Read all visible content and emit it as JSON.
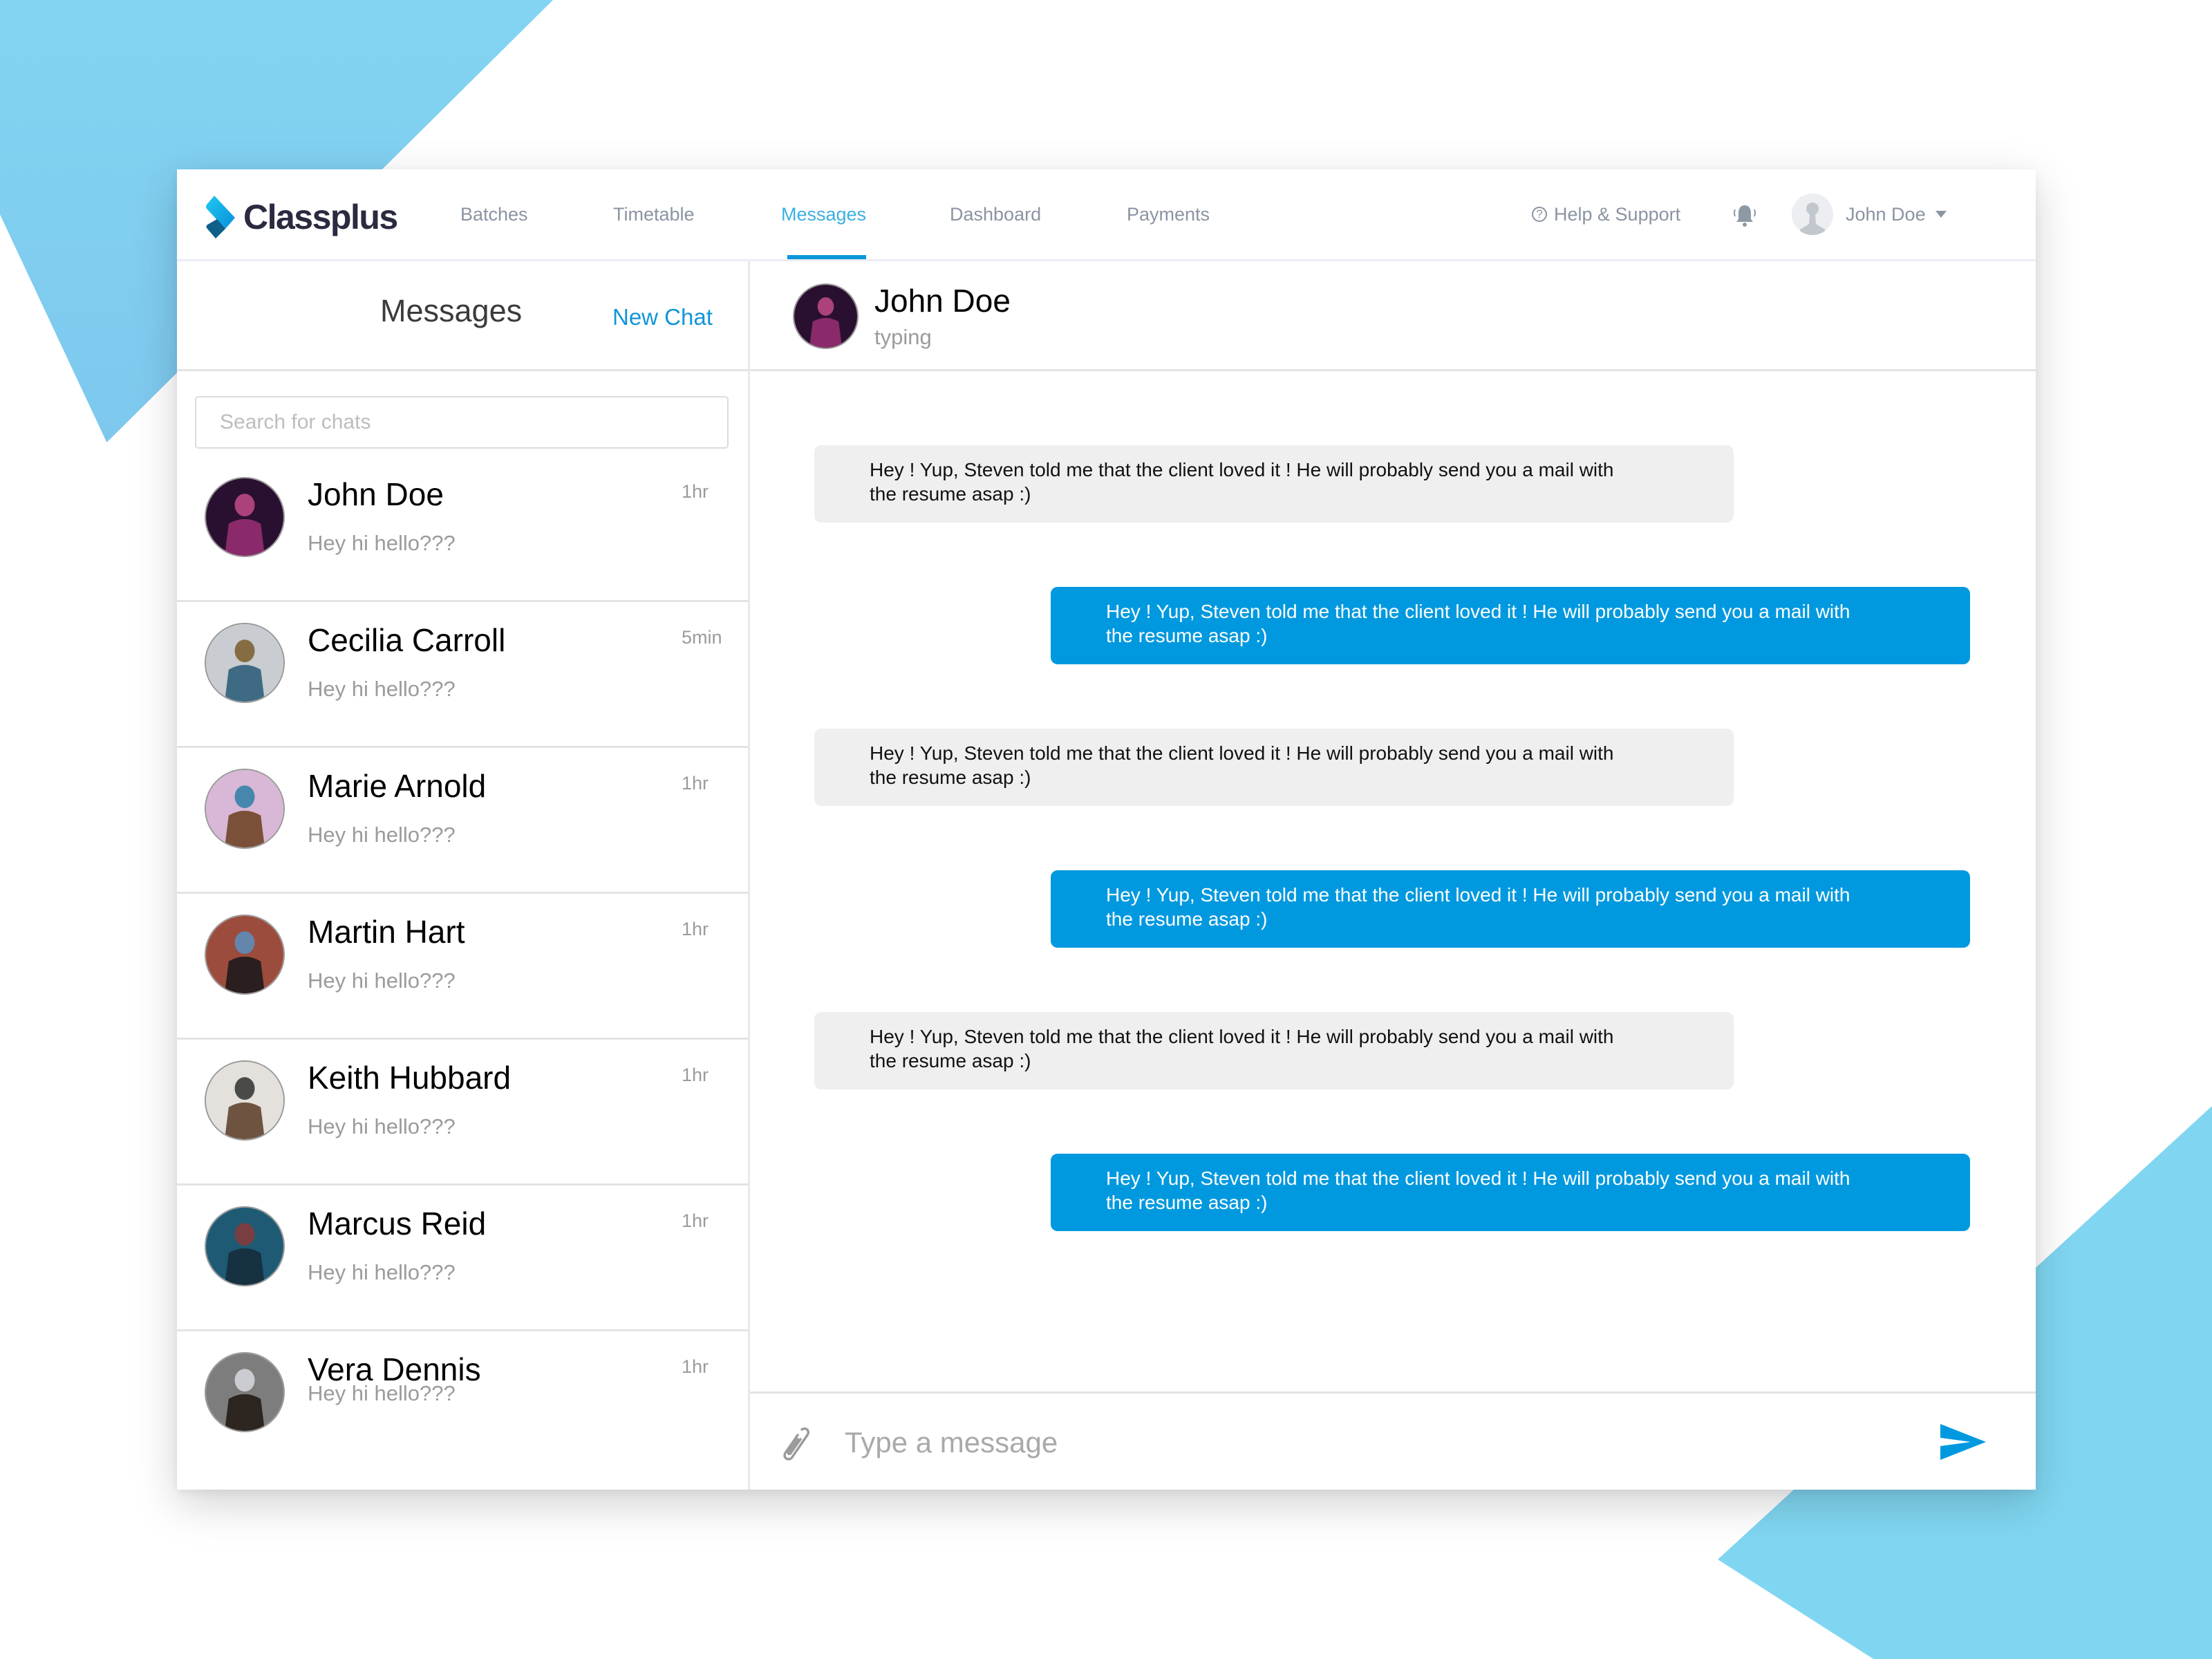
{
  "brand": {
    "name": "Classplus"
  },
  "nav": {
    "items": [
      {
        "label": "Batches",
        "active": false
      },
      {
        "label": "Timetable",
        "active": false
      },
      {
        "label": "Messages",
        "active": true
      },
      {
        "label": "Dashboard",
        "active": false
      },
      {
        "label": "Payments",
        "active": false
      }
    ],
    "help_label": "Help & Support",
    "user_name": "John Doe"
  },
  "sidebar": {
    "title": "Messages",
    "new_chat_label": "New Chat",
    "search_placeholder": "Search for chats",
    "search_value": "",
    "chats": [
      {
        "name": "John Doe",
        "preview": "Hey hi hello???",
        "time": "1hr",
        "avatar_colors": [
          "#2a1030",
          "#8a2a6a",
          "#c34b8a"
        ]
      },
      {
        "name": "Cecilia Carroll",
        "preview": "Hey hi hello???",
        "time": "5min",
        "avatar_colors": [
          "#c9ccd0",
          "#3e6b83",
          "#7a5a2a"
        ]
      },
      {
        "name": "Marie Arnold",
        "preview": "Hey hi hello???",
        "time": "1hr",
        "avatar_colors": [
          "#d9b7d6",
          "#7a5038",
          "#2d7fa6"
        ]
      },
      {
        "name": "Martin Hart",
        "preview": "Hey hi hello???",
        "time": "1hr",
        "avatar_colors": [
          "#9c4c3c",
          "#2b1e1e",
          "#5b8fbf"
        ]
      },
      {
        "name": "Keith Hubbard",
        "preview": "Hey hi hello???",
        "time": "1hr",
        "avatar_colors": [
          "#e4e1dc",
          "#6e5440",
          "#2f2f2f"
        ]
      },
      {
        "name": "Marcus Reid",
        "preview": "Hey hi hello???",
        "time": "1hr",
        "avatar_colors": [
          "#1f5a74",
          "#163142",
          "#8a3a3a"
        ]
      },
      {
        "name": "Vera Dennis",
        "preview": "Hey hi hello???",
        "time": "1hr",
        "avatar_colors": [
          "#7d7d7d",
          "#2c2520",
          "#d8d8e0"
        ]
      }
    ]
  },
  "chat": {
    "contact_name": "John Doe",
    "status": "typing",
    "messages": [
      {
        "direction": "in",
        "line1": "Hey ! Yup, Steven told me that the client loved it ! He will probably send you a mail with",
        "line2": "the resume asap :)"
      },
      {
        "direction": "out",
        "line1": "Hey ! Yup, Steven told me that the client loved it ! He will probably send you a mail with",
        "line2": "the resume asap :)"
      },
      {
        "direction": "in",
        "line1": "Hey ! Yup, Steven told me that the client loved it ! He will probably send you a mail with",
        "line2": "the resume asap :)"
      },
      {
        "direction": "out",
        "line1": "Hey ! Yup, Steven told me that the client loved it ! He will probably send you a mail with",
        "line2": "the resume asap :)"
      },
      {
        "direction": "in",
        "line1": "Hey ! Yup, Steven told me that the client loved it ! He will probably send you a mail with",
        "line2": "the resume asap :)"
      },
      {
        "direction": "out",
        "line1": "Hey ! Yup, Steven told me that the client loved it ! He will probably send you a mail with",
        "line2": "the resume asap :)"
      }
    ],
    "composer_placeholder": "Type a message",
    "composer_value": ""
  },
  "colors": {
    "accent": "#0099df",
    "nav_active": "#3bb0e2",
    "incoming_bubble": "#efefef",
    "background_shape": "#7fd3f1"
  },
  "icons": {
    "logo": "classplus-logo-icon",
    "help": "question-circle-icon",
    "notifications": "bell-icon",
    "user": "user-avatar-icon",
    "dropdown": "caret-down-icon",
    "attach": "paperclip-icon",
    "send": "send-icon"
  }
}
